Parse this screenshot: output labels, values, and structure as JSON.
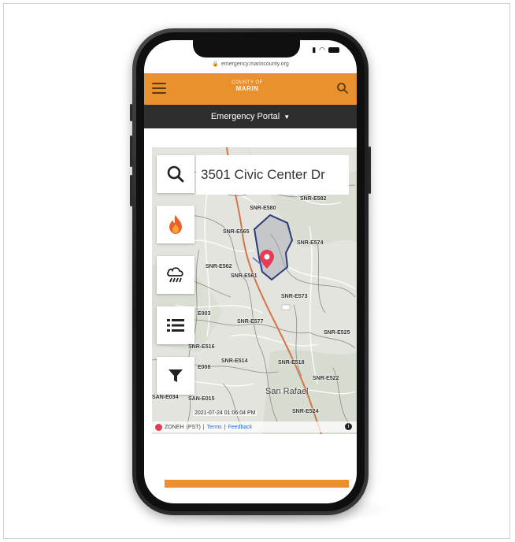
{
  "browser": {
    "url": "emergency.marincounty.org"
  },
  "header": {
    "logo_line1": "COUNTY OF",
    "logo_line2": "MARIN",
    "portal_label": "Emergency Portal"
  },
  "map": {
    "search_value": "3501 Civic Center Dr",
    "zone_labels": [
      "SNR-E580",
      "SNR-E582",
      "SNR-E565",
      "SNR-E574",
      "SNR-E562",
      "SNR-E561",
      "SNR-E573",
      "SNR-E577",
      "SNR-E525",
      "SNR-E516",
      "SNR-E514",
      "SNR-E518",
      "SNR-E522",
      "SAN-E034",
      "SAN-E015",
      "SNR-E524",
      "E003",
      "E008"
    ],
    "city_label": "San Rafael",
    "timestamp": "2021-07-24 01:06:04 PM",
    "attribution": {
      "brand": "ZONEH",
      "pst": "(PST)",
      "terms": "Terms",
      "feedback": "Feedback",
      "separator": "|"
    }
  },
  "tools": [
    {
      "name": "search-tool-button",
      "icon": "search-icon"
    },
    {
      "name": "fire-tool-button",
      "icon": "fire-icon"
    },
    {
      "name": "weather-tool-button",
      "icon": "rain-cloud-icon"
    },
    {
      "name": "list-tool-button",
      "icon": "list-icon"
    },
    {
      "name": "filter-tool-button",
      "icon": "filter-icon"
    }
  ],
  "colors": {
    "accent": "#e8912e",
    "portal_bar": "#2e2e2e",
    "marker": "#e53b57",
    "zone_outline": "#2b3c7a"
  }
}
